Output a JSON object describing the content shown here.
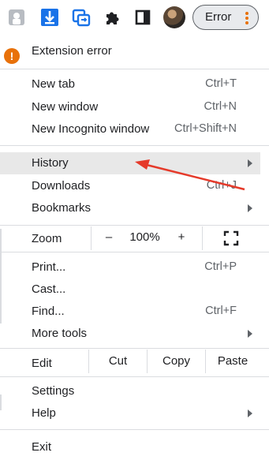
{
  "toolbar": {
    "extensions": [
      "tampermonkey-icon",
      "download-icon",
      "sync-icon",
      "puzzle-icon"
    ],
    "error_label": "Error"
  },
  "menu": {
    "extension_error": "Extension error",
    "new_tab": {
      "label": "New tab",
      "shortcut": "Ctrl+T"
    },
    "new_window": {
      "label": "New window",
      "shortcut": "Ctrl+N"
    },
    "new_incognito": {
      "label": "New Incognito window",
      "shortcut": "Ctrl+Shift+N"
    },
    "history": {
      "label": "History"
    },
    "downloads": {
      "label": "Downloads",
      "shortcut": "Ctrl+J"
    },
    "bookmarks": {
      "label": "Bookmarks"
    },
    "zoom": {
      "label": "Zoom",
      "minus": "–",
      "value": "100%",
      "plus": "+"
    },
    "print": {
      "label": "Print...",
      "shortcut": "Ctrl+P"
    },
    "cast": {
      "label": "Cast..."
    },
    "find": {
      "label": "Find...",
      "shortcut": "Ctrl+F"
    },
    "more_tools": {
      "label": "More tools"
    },
    "edit": {
      "label": "Edit",
      "cut": "Cut",
      "copy": "Copy",
      "paste": "Paste"
    },
    "settings": {
      "label": "Settings"
    },
    "help": {
      "label": "Help"
    },
    "exit": {
      "label": "Exit"
    }
  },
  "colors": {
    "accent_orange": "#e8710a",
    "annotation_arrow": "#e53a2a",
    "highlight": "#e8e8e8"
  }
}
